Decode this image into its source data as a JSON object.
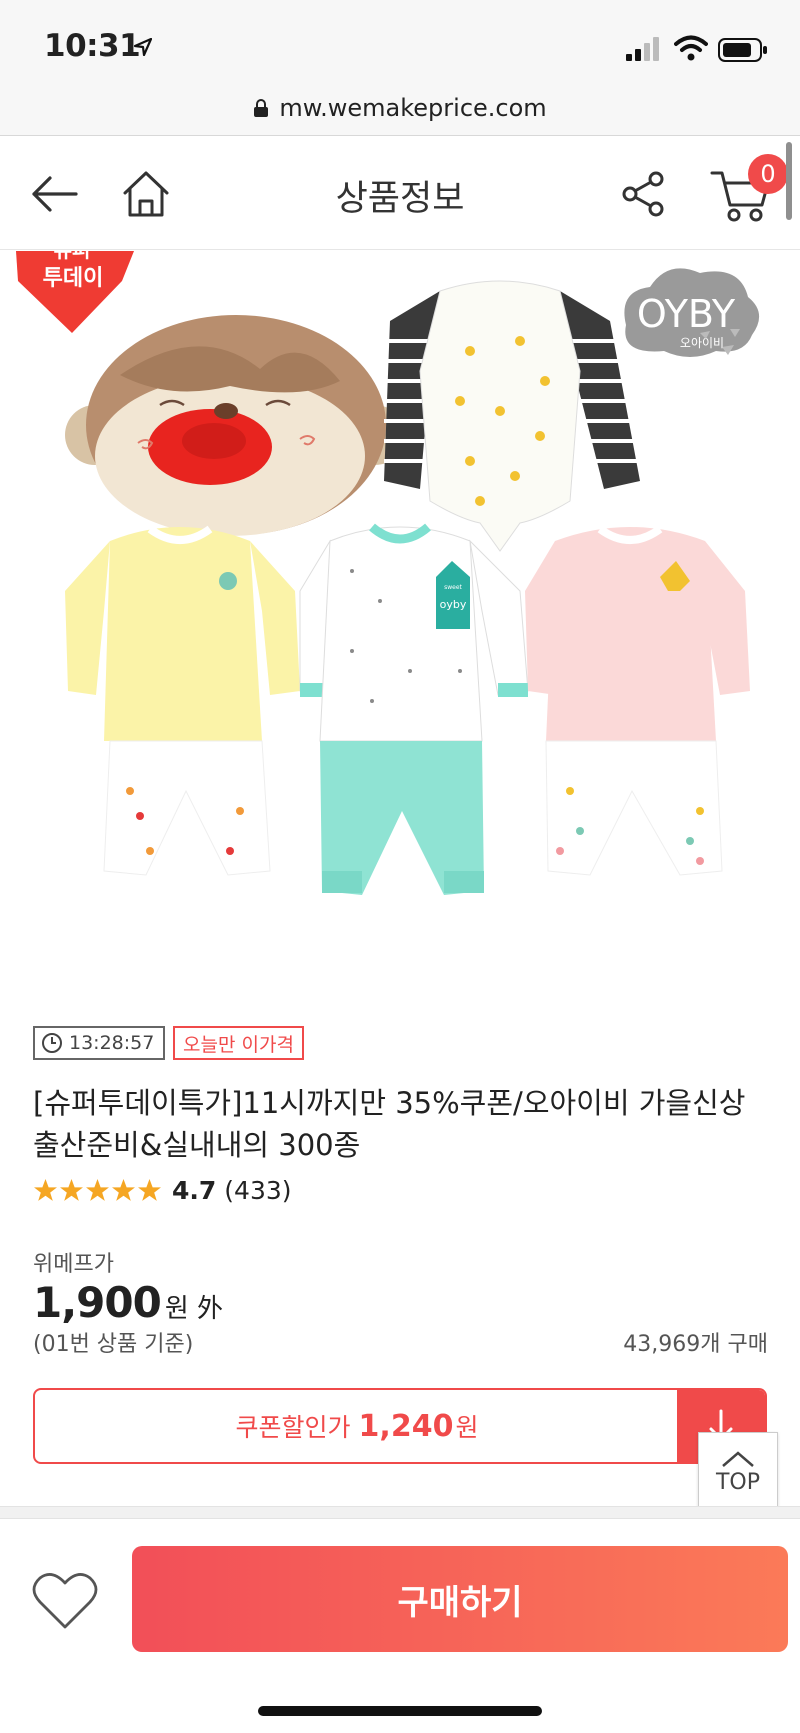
{
  "status_bar": {
    "time": "10:31"
  },
  "browser": {
    "url": "mw.wemakeprice.com"
  },
  "nav": {
    "title": "상품정보",
    "cart_count": "0"
  },
  "hero": {
    "badge_line1": "슈퍼",
    "badge_line2": "투데이",
    "brand_logo": "OYBY",
    "brand_sub": "오아이비",
    "pocket_text": "oyby",
    "pocket_small": "sweet"
  },
  "product": {
    "timer": "13:28:57",
    "today_badge": "오늘만 이가격",
    "title": "[슈퍼투데이특가]11시까지만 35%쿠폰/오아이비 가을신상 출산준비&실내내의 300종",
    "rating": "4.7",
    "review_count": "(433)",
    "stars": 5
  },
  "price": {
    "label": "위메프가",
    "value": "1,900",
    "unit": "원 外",
    "basis": "(01번 상품 기준)",
    "purchase_count": "43,969개 구매"
  },
  "coupon": {
    "label": "쿠폰할인가",
    "price": "1,240",
    "unit": "원"
  },
  "top_button": {
    "label": "TOP"
  },
  "bottom": {
    "buy_label": "구매하기"
  },
  "colors": {
    "accent": "#f04a4a",
    "star": "#f5a623",
    "buy_start": "#f24f58",
    "buy_end": "#fb7a58"
  },
  "icons": [
    "location-arrow-icon",
    "signal-icon",
    "wifi-icon",
    "battery-icon",
    "lock-icon",
    "back-arrow-icon",
    "home-icon",
    "share-icon",
    "cart-icon",
    "clock-icon",
    "star-icon",
    "download-arrow-icon",
    "chevron-up-icon",
    "heart-icon"
  ]
}
